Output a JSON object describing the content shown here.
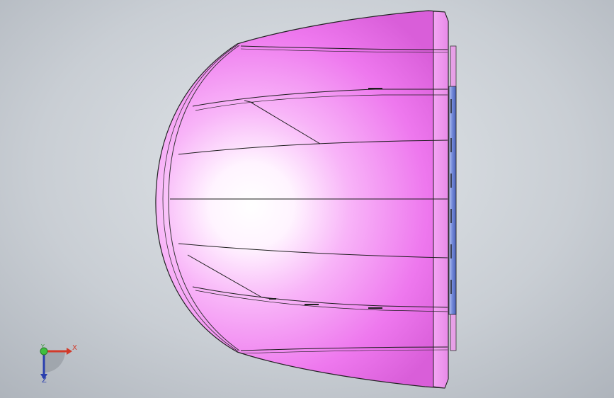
{
  "viewport": {
    "background_top": "#e2e6ea",
    "background_bottom": "#a9afb7"
  },
  "model": {
    "part_color": "#f07ef0",
    "part_highlight": "#ffffff",
    "edge_color": "#1a1a1a",
    "flange_color": "#6f86d8"
  },
  "triad": {
    "x_label": "X",
    "y_label": "Y",
    "z_label": "Z",
    "x_color": "#d23a2a",
    "y_color": "#3a9a3a",
    "z_color": "#2a3fae"
  }
}
